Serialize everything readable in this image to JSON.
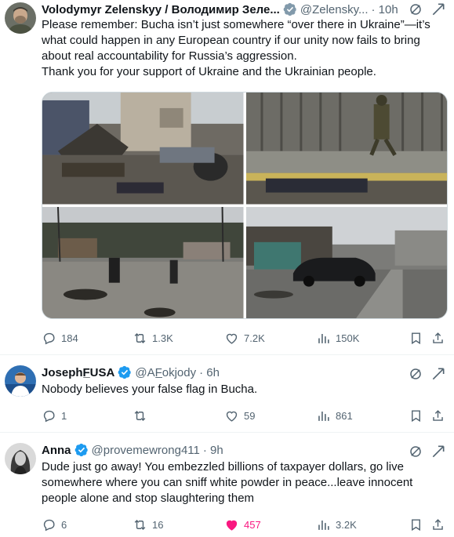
{
  "tweets": [
    {
      "name": "Volodymyr Zelenskyy / Володимир Зеле...",
      "handle": "@Zelensky...",
      "time": "· 10h",
      "text": "Please remember: Bucha isn’t just somewhere “over there in Ukraine”—it’s what could happen in any European country if our unity now fails to bring about real accountability for Russia’s aggression.\nThank you for your support of Ukraine and the Ukrainian people.",
      "stats": {
        "replies": "184",
        "reposts": "1.3K",
        "likes": "7.2K",
        "views": "150K"
      }
    },
    {
      "name": "JosephF̲USA",
      "handle": "@AF̲okjody",
      "time": "· 6h",
      "text": "Nobody believes your false flag in Bucha.",
      "stats": {
        "replies": "1",
        "reposts": "",
        "likes": "59",
        "views": "861"
      }
    },
    {
      "name": "Anna",
      "handle": "@provemewrong411",
      "time": "· 9h",
      "text": "Dude just go away! You embezzled billions of taxpayer dollars, go live somewhere where you can sniff white powder in peace...leave innocent people alone and stop slaughtering them",
      "stats": {
        "replies": "6",
        "reposts": "16",
        "likes": "457",
        "views": "3.2K"
      }
    }
  ],
  "colors": {
    "verified": "#1d9bf0",
    "text_secondary": "#536471",
    "like_active": "#f91880",
    "divider": "#eff3f4"
  },
  "icons": [
    "verified-badge-icon",
    "grok-icon",
    "more-icon",
    "reply-icon",
    "repost-icon",
    "like-icon",
    "views-icon",
    "bookmark-icon",
    "share-icon"
  ]
}
